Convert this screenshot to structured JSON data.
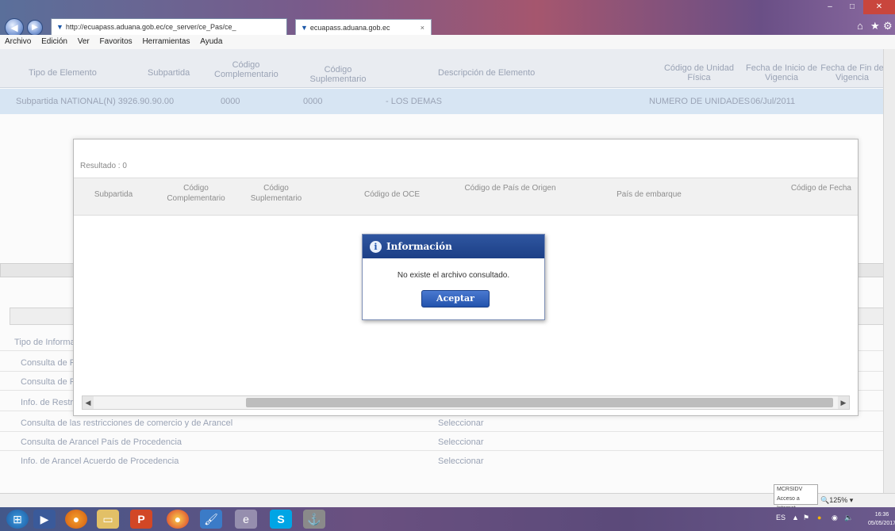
{
  "browser": {
    "address_url": "http://ecuapass.aduana.gob.ec/ce_server/ce_Pas/ce_",
    "tab_title": "ecuapass.aduana.gob.ec",
    "tab_close": "×",
    "icons": [
      "back-arrow-icon",
      "forward-arrow-icon",
      "search-icon",
      "refresh-icon",
      "home-icon",
      "favorites-star-icon",
      "settings-gear-icon"
    ]
  },
  "menu": {
    "items": [
      "Archivo",
      "Edición",
      "Ver",
      "Favoritos",
      "Herramientas",
      "Ayuda"
    ]
  },
  "background_page": {
    "headers": [
      "Tipo de Elemento",
      "Subpartida",
      "Código Complementario",
      "Código Suplementario",
      "Descripción de Elemento",
      "Código de Unidad Física",
      "Fecha de Inicio de Vigencia",
      "Fecha de Fin de Vigencia"
    ],
    "row": [
      "Subpartida NATIONAL(N) 3926.90.90.00",
      "0000",
      "0000",
      "- LOS DEMAS",
      "NUMERO DE UNIDADES",
      "06/Jul/2011"
    ],
    "lower_items": [
      "Tipo de Información",
      "Consulta de Restricciones de Comercio Exterior",
      "Consulta de Restricción",
      "Info. de Restricción",
      "Consulta de las restricciones de comercio y de Arancel",
      "Consulta de Arancel País de Procedencia",
      "Info. de Arancel Acuerdo de Procedencia"
    ],
    "select_word": "Seleccionar"
  },
  "results": {
    "count_label": "Resultado : 0",
    "columns": [
      "Subpartida",
      "Código Complementario",
      "Código Suplementario",
      "Código de OCE",
      "Código de País de Origen",
      "País de embarque",
      "Código de Fecha"
    ]
  },
  "dialog": {
    "title": "Información",
    "message": "No existe el archivo consultado.",
    "ok_label": "Aceptar",
    "icon": "info-icon"
  },
  "statusbar": {
    "zone_line1": "MCRSIDV",
    "zone_line2": "Acceso a Internet",
    "zoom": "125%"
  },
  "taskbar": {
    "apps": [
      "windows-start-icon",
      "media-player-icon",
      "firefox-icon",
      "file-explorer-icon",
      "powerpoint-icon",
      "chrome-icon",
      "paint-icon",
      "internet-explorer-icon",
      "skype-icon",
      "network-app-icon"
    ],
    "tray_language": "ES",
    "clock_time": "16:36",
    "clock_date": "05/05/2017"
  },
  "colors": {
    "dialog_header": "#2a4f98",
    "button_blue": "#2f60b8",
    "results_header": "#f1f1f1"
  }
}
